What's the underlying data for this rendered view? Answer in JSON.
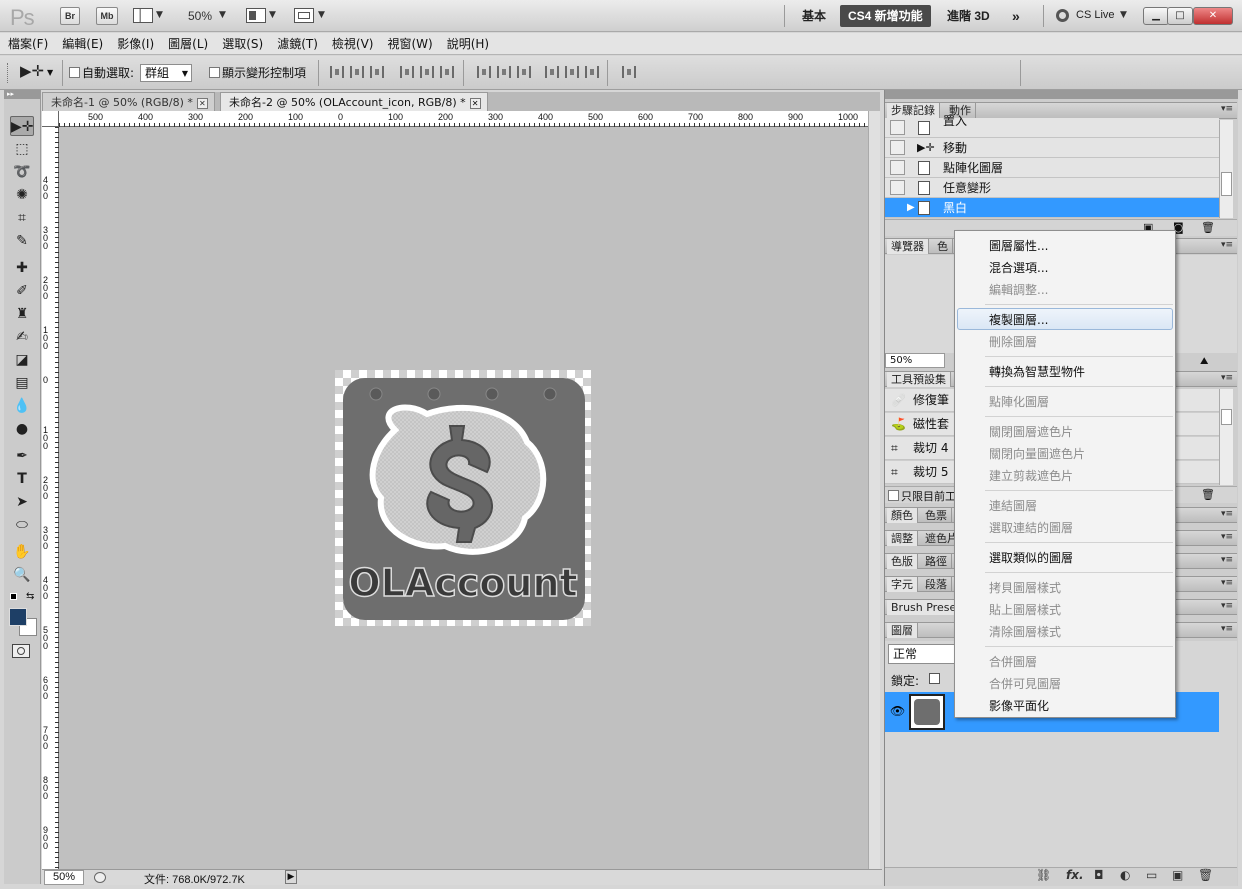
{
  "appbar": {
    "logo": "Ps",
    "bridge": "Br",
    "minibridge": "Mb",
    "zoom": "50%",
    "workspaces": [
      "基本",
      "CS4 新增功能",
      "進階 3D"
    ],
    "more": "»",
    "cslive": "CS Live"
  },
  "menubar": [
    "檔案(F)",
    "編輯(E)",
    "影像(I)",
    "圖層(L)",
    "選取(S)",
    "濾鏡(T)",
    "檢視(V)",
    "視窗(W)",
    "說明(H)"
  ],
  "options": {
    "auto_select_label": "自動選取:",
    "auto_select_value": "群組",
    "transform_label": "顯示變形控制項"
  },
  "tabs": [
    {
      "label": "未命名-1 @ 50% (RGB/8) *"
    },
    {
      "label": "未命名-2 @ 50% (OLAccount_icon, RGB/8) *"
    }
  ],
  "ruler": {
    "h": [
      "500",
      "400",
      "300",
      "200",
      "100",
      "0",
      "100",
      "200",
      "300",
      "400",
      "500",
      "600",
      "700",
      "800",
      "900",
      "1000"
    ],
    "v": [
      "400",
      "300",
      "200",
      "100",
      "0",
      "100",
      "200",
      "300",
      "400",
      "500",
      "600",
      "700",
      "800",
      "900"
    ]
  },
  "canvas": {
    "icon_text": "OLAccount",
    "bg_color": "#c0c0c0"
  },
  "status": {
    "zoom": "50%",
    "doc": "文件: 768.0K/972.7K"
  },
  "history": {
    "tabs": [
      "步驟記錄",
      "動作"
    ],
    "items": [
      {
        "label": "置入"
      },
      {
        "label": "移動"
      },
      {
        "label": "點陣化圖層"
      },
      {
        "label": "任意變形"
      },
      {
        "label": "黑白"
      }
    ]
  },
  "navigator": {
    "tabs": [
      "導覽器",
      "色"
    ],
    "zoom": "50%"
  },
  "toolpresets": {
    "title": "工具預設集",
    "items": [
      "修復筆",
      "磁性套",
      "裁切 4",
      "裁切 5"
    ],
    "current_only": "只限目前工"
  },
  "panel_groups": [
    [
      "顏色",
      "色票"
    ],
    [
      "調整",
      "遮色片"
    ],
    [
      "色版",
      "路徑"
    ],
    [
      "字元",
      "段落"
    ],
    [
      "Brush Presets"
    ],
    [
      "圖層"
    ]
  ],
  "layers": {
    "blend": "正常",
    "lock_label": "鎖定:"
  },
  "context_menu": {
    "items": [
      {
        "label": "圖層屬性...",
        "enabled": true
      },
      {
        "label": "混合選項...",
        "enabled": true
      },
      {
        "label": "編輯調整...",
        "enabled": false
      },
      {
        "label": "複製圖層...",
        "enabled": true
      },
      {
        "label": "刪除圖層",
        "enabled": false
      },
      {
        "label": "轉換為智慧型物件",
        "enabled": true
      },
      {
        "label": "點陣化圖層",
        "enabled": false
      },
      {
        "label": "關閉圖層遮色片",
        "enabled": false
      },
      {
        "label": "關閉向量圖遮色片",
        "enabled": false
      },
      {
        "label": "建立剪裁遮色片",
        "enabled": false
      },
      {
        "label": "連結圖層",
        "enabled": false
      },
      {
        "label": "選取連結的圖層",
        "enabled": false
      },
      {
        "label": "選取類似的圖層",
        "enabled": true
      },
      {
        "label": "拷貝圖層樣式",
        "enabled": false
      },
      {
        "label": "貼上圖層樣式",
        "enabled": false
      },
      {
        "label": "清除圖層樣式",
        "enabled": false
      },
      {
        "label": "合併圖層",
        "enabled": false
      },
      {
        "label": "合併可見圖層",
        "enabled": false
      },
      {
        "label": "影像平面化",
        "enabled": true
      }
    ]
  }
}
